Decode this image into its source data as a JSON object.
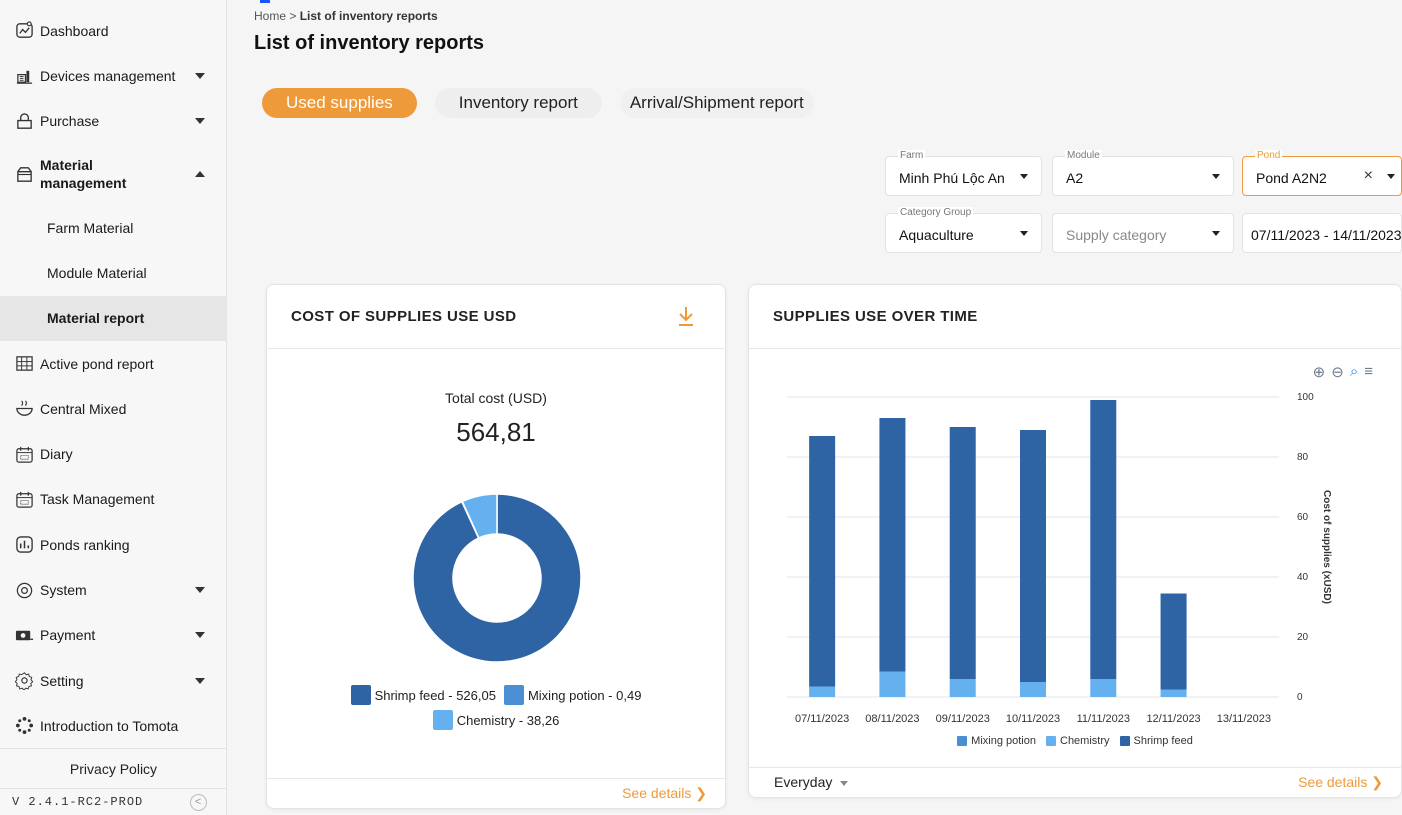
{
  "sidebar": {
    "items": [
      {
        "label": "Dashboard",
        "icon": "dashboard-icon"
      },
      {
        "label": "Devices management",
        "icon": "devices-icon"
      },
      {
        "label": "Purchase",
        "icon": "purchase-icon"
      },
      {
        "label": "Material management",
        "icon": "material-icon"
      },
      {
        "label": "Active pond report",
        "icon": "grid-icon"
      },
      {
        "label": "Central Mixed",
        "icon": "mixing-bowl-icon"
      },
      {
        "label": "Diary",
        "icon": "calendar-icon"
      },
      {
        "label": "Task Management",
        "icon": "calendar-icon"
      },
      {
        "label": "Ponds ranking",
        "icon": "ranking-icon"
      },
      {
        "label": "System",
        "icon": "system-icon"
      },
      {
        "label": "Payment",
        "icon": "payment-icon"
      },
      {
        "label": "Setting",
        "icon": "gear-icon"
      },
      {
        "label": "Introduction to Tomota",
        "icon": "tomota-logo-icon"
      }
    ],
    "material_label_line1": "Material",
    "material_label_line2": "management",
    "sub_items": [
      {
        "label": "Farm Material"
      },
      {
        "label": "Module Material"
      },
      {
        "label": "Material report"
      }
    ],
    "privacy": "Privacy Policy",
    "version": "V 2.4.1-RC2-PROD"
  },
  "header": {
    "breadcrumb_home": "Home",
    "breadcrumb_sep": " > ",
    "breadcrumb_current": "List of inventory reports",
    "title": "List of inventory reports"
  },
  "tabs": [
    {
      "label": "Used supplies"
    },
    {
      "label": "Inventory report"
    },
    {
      "label": "Arrival/Shipment report"
    }
  ],
  "filters": {
    "farm": {
      "label": "Farm",
      "value": "Minh Phú Lộc An"
    },
    "module": {
      "label": "Module",
      "value": "A2"
    },
    "pond": {
      "label": "Pond",
      "value": "Pond A2N2"
    },
    "category_group": {
      "label": "Category Group",
      "value": "Aquaculture"
    },
    "supply_category": {
      "placeholder": "Supply category"
    },
    "date_range": {
      "value": "07/11/2023 - 14/11/2023"
    }
  },
  "cost_card": {
    "title": "COST OF SUPPLIES USE USD",
    "total_label": "Total cost (USD)",
    "total_value": "564,81",
    "legend": [
      {
        "label": "Shrimp feed - 526,05",
        "color": "#2e63a4"
      },
      {
        "label": "Mixing potion - 0,49",
        "color": "#4a8fd4"
      },
      {
        "label": "Chemistry - 38,26",
        "color": "#65b1f0"
      }
    ],
    "see_details": "See details"
  },
  "time_card": {
    "title": "SUPPLIES USE OVER TIME",
    "period": "Everyday",
    "see_details": "See details",
    "legend": [
      {
        "label": "Mixing potion",
        "color": "#4a8fd4"
      },
      {
        "label": "Chemistry",
        "color": "#65b1f0"
      },
      {
        "label": "Shrimp feed",
        "color": "#2e63a4"
      }
    ]
  },
  "chart_data": [
    {
      "type": "pie",
      "labels": [
        "Shrimp feed",
        "Mixing potion",
        "Chemistry"
      ],
      "values": [
        526.05,
        0.49,
        38.26
      ],
      "colors": [
        "#2e63a4",
        "#4a8fd4",
        "#65b1f0"
      ]
    },
    {
      "type": "bar",
      "stacked": true,
      "categories": [
        "07/11/2023",
        "08/11/2023",
        "09/11/2023",
        "10/11/2023",
        "11/11/2023",
        "12/11/2023",
        "13/11/2023"
      ],
      "series": [
        {
          "name": "Mixing potion",
          "values": [
            0,
            0,
            0,
            0,
            0,
            0,
            0
          ],
          "color": "#4a8fd4"
        },
        {
          "name": "Chemistry",
          "values": [
            3.5,
            8.5,
            6,
            5,
            6,
            2.5,
            0
          ],
          "color": "#65b1f0"
        },
        {
          "name": "Shrimp feed",
          "values": [
            83.5,
            84.5,
            84,
            84,
            93,
            32,
            0
          ],
          "color": "#2e63a4"
        }
      ],
      "ylabel": "Cost of supplies (xUSD)",
      "ylim": [
        0,
        100
      ],
      "yticks": [
        0,
        20,
        40,
        60,
        80,
        100
      ],
      "y_axis_position": "right",
      "grid": true,
      "legend_position": "bottom"
    }
  ]
}
